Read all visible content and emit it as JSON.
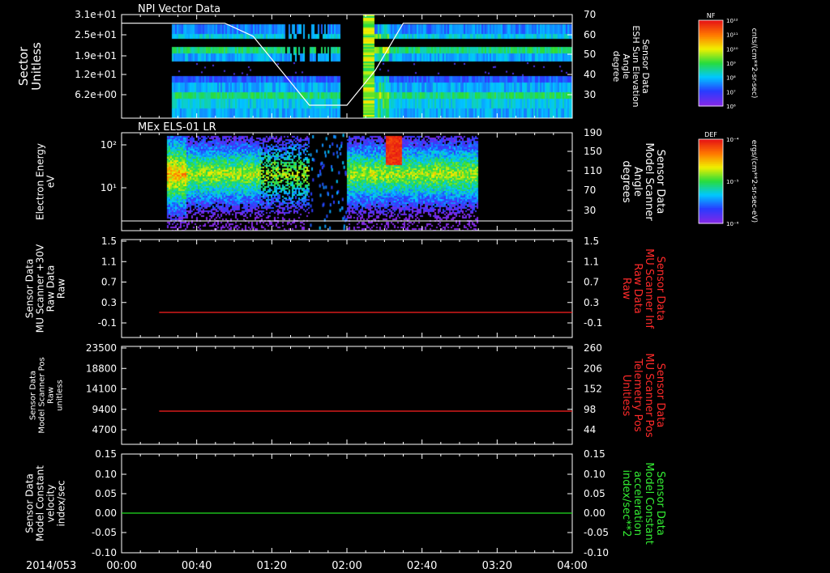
{
  "date_label": "2014/053",
  "time_ticks": [
    "00:00",
    "00:40",
    "01:20",
    "02:00",
    "02:40",
    "03:20",
    "04:00"
  ],
  "chart_data": [
    {
      "type": "heatmap",
      "title": "NPI Vector Data",
      "ylabel": [
        "Sector",
        "Unitless"
      ],
      "y_ticks": [
        "3.1e+01",
        "2.5e+01",
        "1.9e+01",
        "1.2e+01",
        "6.2e+00"
      ],
      "right_ylabel": [
        "Sensor Data",
        "ESH Sun Elevation",
        "Angle",
        "degree"
      ],
      "right_ticks": [
        "70",
        "60",
        "50",
        "40",
        "30"
      ],
      "overlay_line": {
        "x": [
          "00:00",
          "00:55",
          "01:10",
          "01:25",
          "01:40",
          "02:00",
          "02:15",
          "02:30",
          "04:00"
        ],
        "y": [
          66,
          66,
          60,
          44,
          28,
          28,
          44,
          66,
          66
        ]
      },
      "colorbar": {
        "label": "NF",
        "unit": "cnts/(cm**2-sr-sec)",
        "ticks": [
          "10¹²",
          "10¹¹",
          "10¹⁰",
          "10⁹",
          "10⁸",
          "10⁷",
          "10⁶"
        ]
      }
    },
    {
      "type": "heatmap",
      "title": "MEx ELS-01 LR",
      "ylabel": [
        "Electron Energy",
        "eV"
      ],
      "y_ticks": [
        "10²",
        "10¹"
      ],
      "right_ylabel": [
        "Sensor Data",
        "Model Scanner",
        "Angle",
        "degrees"
      ],
      "right_ticks": [
        "190",
        "150",
        "110",
        "70",
        "30"
      ],
      "colorbar": {
        "label": "DEF",
        "unit": "ergs/(cm**2-sr-sec-eV)",
        "ticks": [
          "10⁻⁴",
          "10⁻⁵",
          "10⁻⁶"
        ]
      }
    },
    {
      "type": "line",
      "ylabel": [
        "Sensor Data",
        "MU Scanner +30V",
        "Raw Data",
        "Raw"
      ],
      "y_ticks": [
        "1.5",
        "1.1",
        "0.7",
        "0.3",
        "-0.1"
      ],
      "right_ylabel": [
        "Sensor Data",
        "MU Scanner Inf",
        "Raw Data",
        "Raw"
      ],
      "right_ticks": [
        "1.5",
        "1.1",
        "0.7",
        "0.3",
        "-0.1"
      ],
      "series": [
        {
          "x": [
            "00:20",
            "04:00"
          ],
          "y": [
            0.0,
            0.0
          ],
          "color": "#ff2020"
        }
      ]
    },
    {
      "type": "line",
      "ylabel": [
        "Sensor Data",
        "Model Scanner Pos",
        "Raw",
        "unitless"
      ],
      "y_ticks": [
        "23500",
        "18800",
        "14100",
        "9400",
        "4700"
      ],
      "right_ylabel": [
        "Sensor Data",
        "MU Scanner Pos",
        "Telemetry Pos",
        "Unitless"
      ],
      "right_ticks": [
        "260",
        "206",
        "152",
        "98",
        "44"
      ],
      "series": [
        {
          "x": [
            "00:20",
            "04:00"
          ],
          "y": [
            8000,
            8000
          ],
          "color": "#ff2020"
        }
      ]
    },
    {
      "type": "line",
      "ylabel": [
        "Sensor Data",
        "Model Constant",
        "velocity",
        "index/sec"
      ],
      "y_ticks": [
        "0.15",
        "0.10",
        "0.05",
        "0.00",
        "-0.05",
        "-0.10"
      ],
      "right_ylabel": [
        "Sensor Data",
        "Model Constant",
        "acceleration",
        "index/sec**2"
      ],
      "right_ticks": [
        "0.15",
        "0.10",
        "0.05",
        "0.00",
        "-0.05",
        "-0.10"
      ],
      "series": [
        {
          "x": [
            "00:00",
            "04:00"
          ],
          "y": [
            0.0,
            0.0
          ],
          "color": "#20e020"
        }
      ]
    }
  ]
}
